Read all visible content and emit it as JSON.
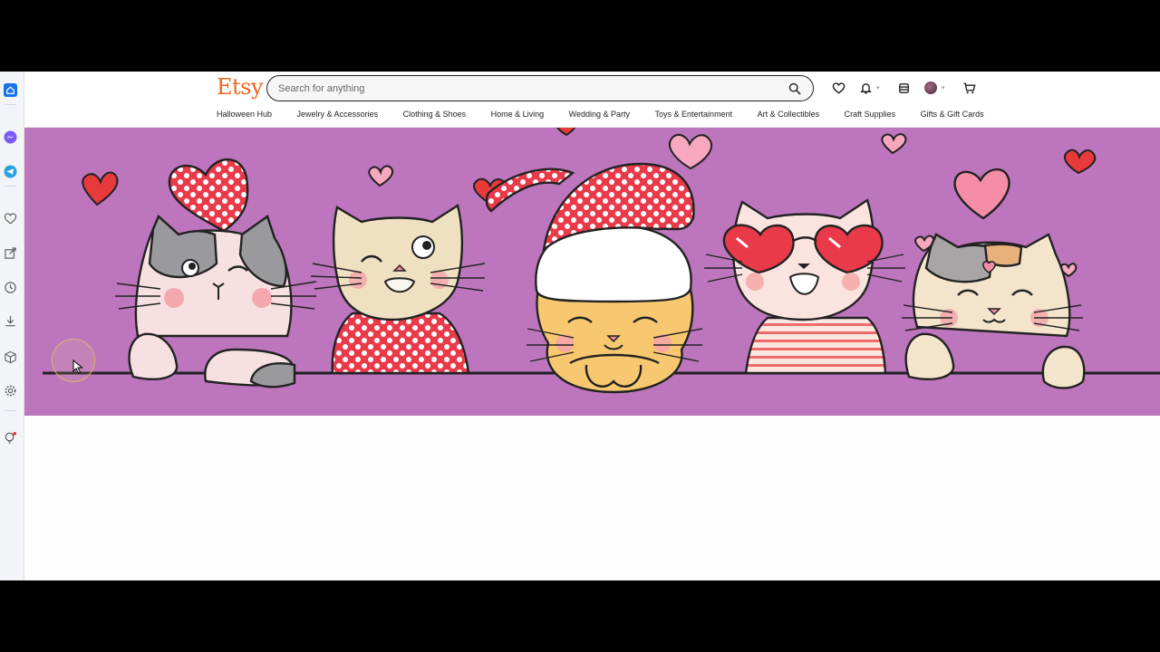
{
  "brand": {
    "logo_text": "Etsy",
    "accent_color": "#f1641e"
  },
  "search": {
    "placeholder": "Search for anything"
  },
  "header_icons": [
    "heart-icon",
    "bell-icon",
    "gift-registry-icon",
    "user-avatar",
    "cart-icon"
  ],
  "nav": {
    "items": [
      "Halloween Hub",
      "Jewelry & Accessories",
      "Clothing & Shoes",
      "Home & Living",
      "Wedding & Party",
      "Toys & Entertainment",
      "Art & Collectibles",
      "Craft Supplies",
      "Gifts & Gift Cards"
    ]
  },
  "sidebar_icons": [
    "home-icon",
    "messenger-icon",
    "telegram-icon",
    "heart-icon",
    "send-icon",
    "history-icon",
    "download-icon",
    "box-icon",
    "settings-icon",
    "lightbulb-icon"
  ],
  "banner": {
    "background_color": "#bd76bd",
    "illustration": "cats-with-hearts-icon"
  }
}
